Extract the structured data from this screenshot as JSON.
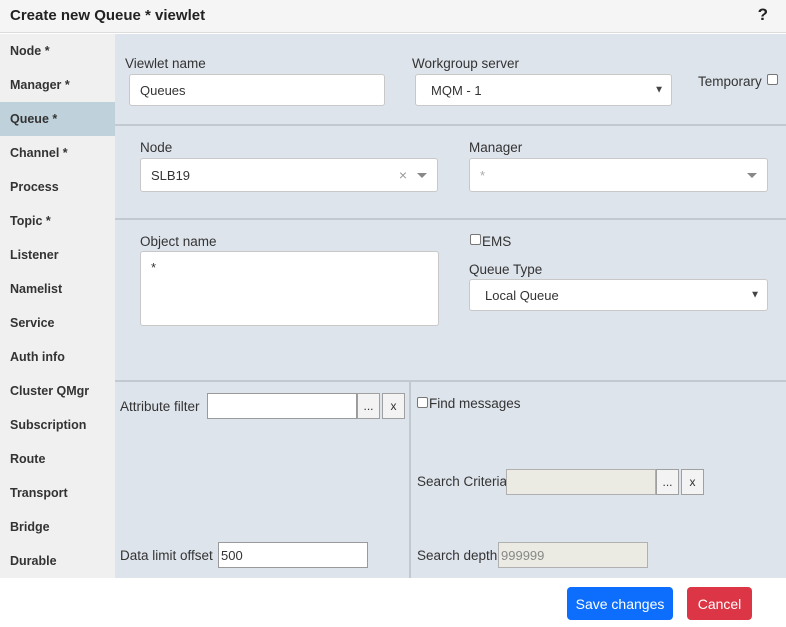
{
  "dialog": {
    "title": "Create new Queue * viewlet",
    "help": "?"
  },
  "sidebar": {
    "items": [
      {
        "label": "Node *"
      },
      {
        "label": "Manager *"
      },
      {
        "label": "Queue *"
      },
      {
        "label": "Channel *"
      },
      {
        "label": "Process"
      },
      {
        "label": "Topic *"
      },
      {
        "label": "Listener"
      },
      {
        "label": "Namelist"
      },
      {
        "label": "Service"
      },
      {
        "label": "Auth info"
      },
      {
        "label": "Cluster QMgr"
      },
      {
        "label": "Subscription"
      },
      {
        "label": "Route"
      },
      {
        "label": "Transport"
      },
      {
        "label": "Bridge"
      },
      {
        "label": "Durable"
      }
    ],
    "active": "Queue *"
  },
  "form": {
    "viewlet_name": {
      "label": "Viewlet name",
      "value": "Queues"
    },
    "workgroup_server": {
      "label": "Workgroup server",
      "value": "MQM - 1"
    },
    "temporary": {
      "label": "Temporary",
      "checked": false
    },
    "node": {
      "label": "Node",
      "value": "SLB19",
      "clear": "×"
    },
    "manager": {
      "label": "Manager",
      "placeholder": "*"
    },
    "object_name": {
      "label": "Object name",
      "value": "*"
    },
    "ems": {
      "label": "EMS",
      "checked": false
    },
    "queue_type": {
      "label": "Queue Type",
      "value": "Local Queue"
    },
    "attribute_filter": {
      "label": "Attribute filter",
      "value": "",
      "more": "...",
      "clear": "x"
    },
    "find_messages": {
      "label": "Find messages",
      "checked": false
    },
    "search_criteria": {
      "label": "Search Criteria",
      "value": "",
      "more": "...",
      "clear": "x"
    },
    "data_limit_offset": {
      "label": "Data limit offset",
      "value": "500"
    },
    "search_depth": {
      "label": "Search depth",
      "value": "999999"
    }
  },
  "footer": {
    "save_label": "Save changes",
    "cancel_label": "Cancel"
  },
  "colors": {
    "save": "#0d6efd",
    "cancel": "#dc3545",
    "panel": "#dee4ec",
    "sidebar_active": "#bfd2dc"
  }
}
